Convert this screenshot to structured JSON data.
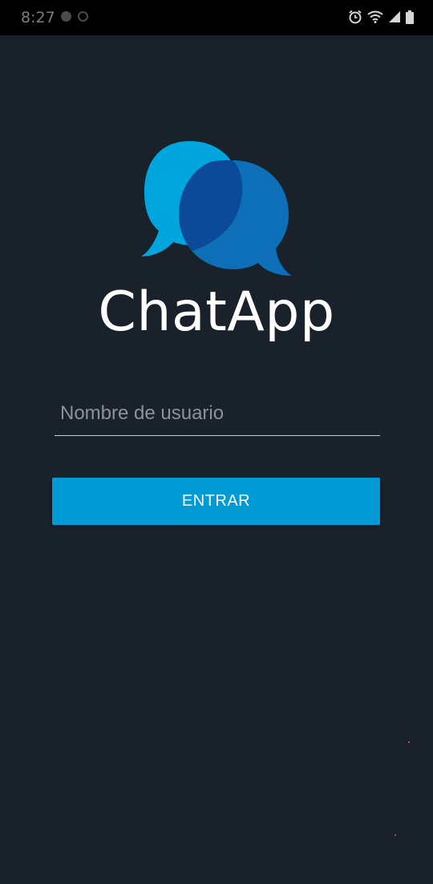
{
  "status_bar": {
    "time": "8:27",
    "left_icons": [
      "notification-icon",
      "at-icon"
    ],
    "right_icons": [
      "alarm-icon",
      "wifi-icon",
      "signal-icon",
      "battery-icon"
    ]
  },
  "app": {
    "title": "ChatApp",
    "logo": "chat-bubbles-logo"
  },
  "login": {
    "username_placeholder": "Nombre de usuario",
    "username_value": "",
    "enter_label": "ENTRAR"
  },
  "colors": {
    "background": "#19212b",
    "status_bar": "#000000",
    "button": "#009bd4",
    "bubble_light": "#00a6dd",
    "bubble_dark": "#0d6fb8",
    "overlap": "#0a4a99"
  }
}
